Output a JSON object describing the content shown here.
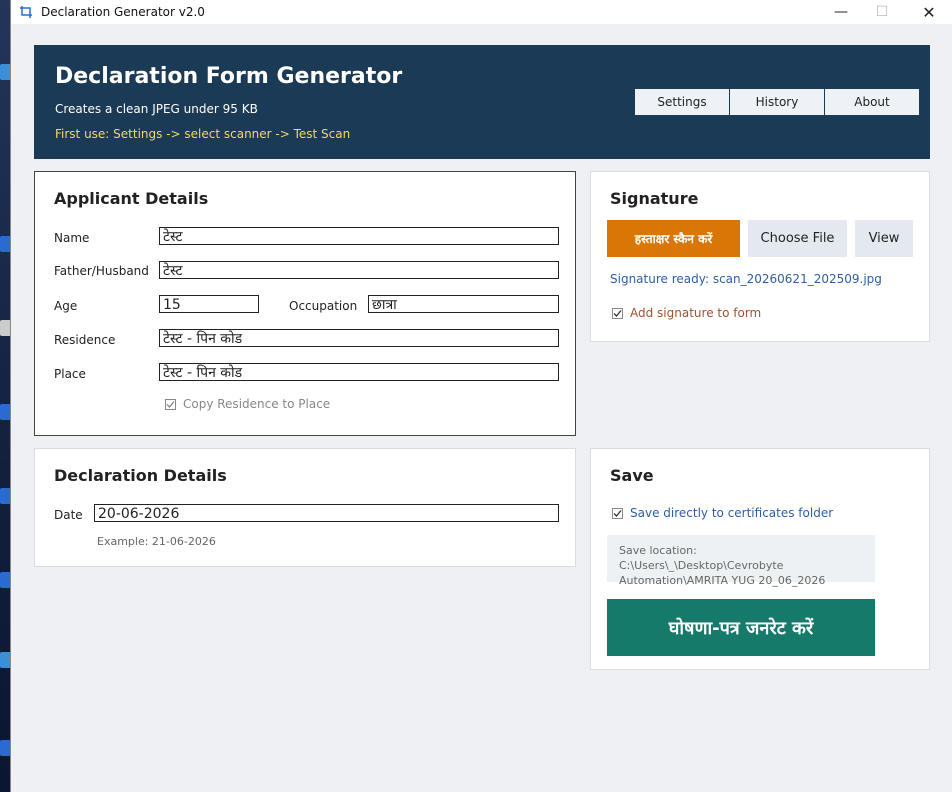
{
  "window": {
    "title": "Declaration Generator v2.0",
    "controls": {
      "minimize": "—",
      "maximize": "☐",
      "close": "✕"
    }
  },
  "header": {
    "title": "Declaration Form Generator",
    "subtitle": "Creates a clean JPEG under 95 KB",
    "hint": "First use: Settings -> select scanner -> Test Scan",
    "buttons": {
      "settings": "Settings",
      "history": "History",
      "about": "About"
    }
  },
  "applicant": {
    "title": "Applicant Details",
    "name_label": "Name",
    "name_value": "टेस्ट",
    "father_label": "Father/Husband",
    "father_value": "टेस्ट",
    "age_label": "Age",
    "age_value": "15",
    "occupation_label": "Occupation",
    "occupation_value": "छात्रा",
    "residence_label": "Residence",
    "residence_value": "टेस्ट - पिन कोड",
    "place_label": "Place",
    "place_value": "टेस्ट - पिन कोड",
    "copy_label": "Copy Residence to Place",
    "copy_checked": true
  },
  "signature": {
    "title": "Signature",
    "scan_button": "हस्ताक्षर स्कैन करें",
    "choose_button": "Choose File",
    "view_button": "View",
    "status": "Signature ready: scan_20260621_202509.jpg",
    "add_label": "Add signature to form",
    "add_checked": true
  },
  "declaration": {
    "title": "Declaration Details",
    "date_label": "Date",
    "date_value": "20-06-2026",
    "example": "Example: 21-06-2026"
  },
  "save": {
    "title": "Save",
    "direct_label": "Save directly to certificates folder",
    "direct_checked": true,
    "location_line1": "Save location: C:\\Users\\_\\Desktop\\Cevrobyte",
    "location_line2": "Automation\\AMRITA YUG 20_06_2026",
    "generate_button": "घोषणा-पत्र जनरेट करें"
  },
  "colors": {
    "header_bg": "#1a3a56",
    "hint": "#f4d76a",
    "orange": "#d97706",
    "green": "#167a6b",
    "link_blue": "#2f5fa0",
    "sig_label": "#a0522d"
  },
  "icons": [
    "app-icon",
    "minimize-icon",
    "maximize-icon",
    "close-icon",
    "checkmark-icon"
  ]
}
